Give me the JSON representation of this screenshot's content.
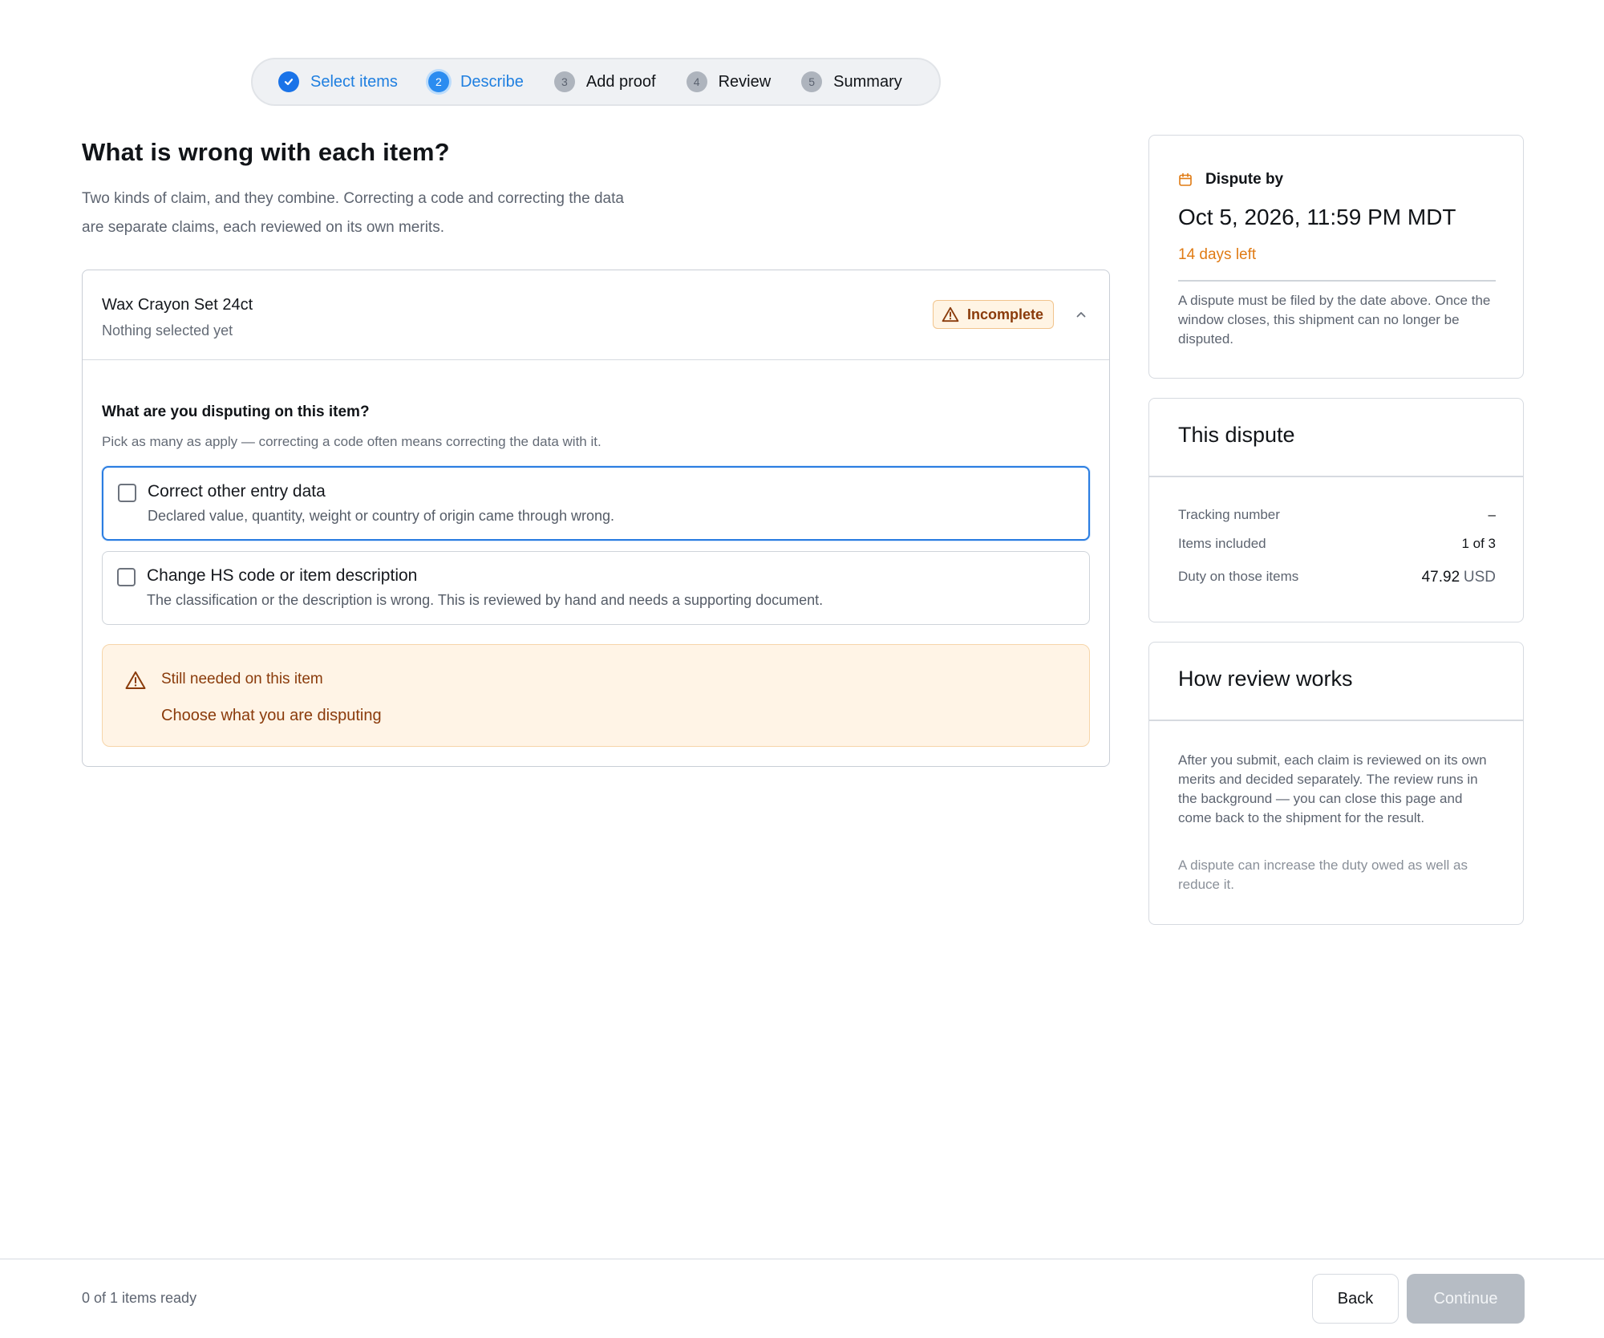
{
  "stepper": {
    "steps": [
      {
        "number": "",
        "label": "Select items",
        "state": "done"
      },
      {
        "number": "2",
        "label": "Describe",
        "state": "active"
      },
      {
        "number": "3",
        "label": "Add proof",
        "state": "pending"
      },
      {
        "number": "4",
        "label": "Review",
        "state": "pending"
      },
      {
        "number": "5",
        "label": "Summary",
        "state": "pending"
      }
    ]
  },
  "main": {
    "title": "What is wrong with each item?",
    "intro_line1": "Two kinds of claim, and they combine. Correcting a code and correcting the data",
    "intro_line2": "are separate claims, each reviewed on its own merits.",
    "item": {
      "name": "Wax Crayon Set 24ct",
      "subtitle": "Nothing selected yet",
      "status_badge": "Incomplete",
      "question_title": "What are you disputing on this item?",
      "question_sub": "Pick as many as apply — correcting a code often means correcting the data with it.",
      "options": [
        {
          "title": "Correct other entry data",
          "description": "Declared value, quantity, weight or country of origin came through wrong.",
          "checked": false
        },
        {
          "title": "Change HS code or item description",
          "description": "The classification or the description is wrong. This is reviewed by hand and needs a supporting document.",
          "checked": false
        }
      ],
      "warning": {
        "title": "Still needed on this item",
        "items": [
          "Choose what you are disputing"
        ]
      }
    }
  },
  "sidebar": {
    "deadline": {
      "heading": "Dispute by",
      "date": "Oct 5, 2026, 11:59 PM MDT",
      "days_left": "14 days left",
      "note": "A dispute must be filed by the date above. Once the window closes, this shipment can no longer be disputed."
    },
    "dispute": {
      "title": "This dispute",
      "rows": [
        {
          "label": "Tracking number",
          "value": "–"
        },
        {
          "label": "Items included",
          "value": "1 of 3"
        },
        {
          "label": "Duty on those items",
          "value": "47.92",
          "unit": "USD"
        }
      ]
    },
    "review": {
      "title": "How review works",
      "text": "After you submit, each claim is reviewed on its own merits and decided separately. The review runs in the background — you can close this page and come back to the shipment for the result.",
      "note": "A dispute can increase the duty owed as well as reduce it."
    }
  },
  "footer": {
    "ready_text": "0 of 1 items ready",
    "back_label": "Back",
    "continue_label": "Continue"
  },
  "colors": {
    "accent": "#1a73e8",
    "warning": "#8a3b0b",
    "days_left": "#e07b14",
    "disabled_button": "#b6bcc4"
  }
}
